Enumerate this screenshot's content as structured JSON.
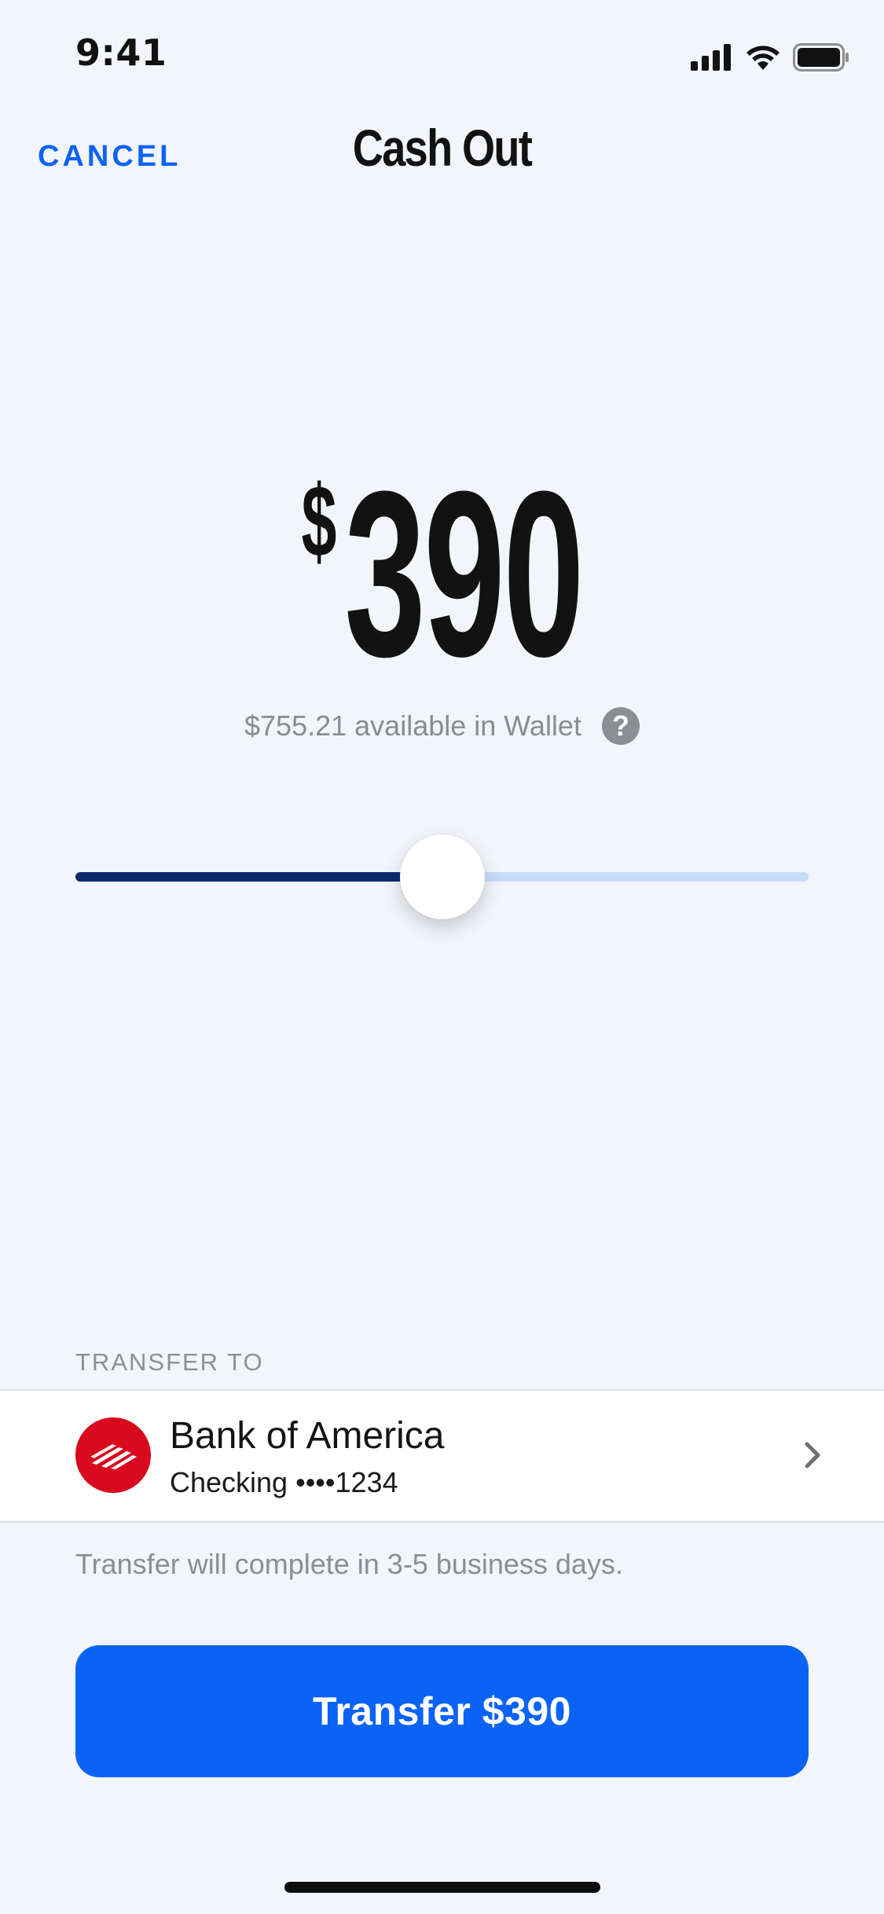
{
  "status_bar": {
    "time": "9:41"
  },
  "nav": {
    "cancel_label": "CANCEL",
    "title": "Cash Out"
  },
  "amount": {
    "currency": "$",
    "value": "390",
    "available_text": "$755.21 available in Wallet",
    "help_symbol": "?"
  },
  "slider": {
    "fraction": 0.5
  },
  "transfer": {
    "section_label": "TRANSFER TO",
    "bank_name": "Bank of America",
    "account": "Checking ••••1234",
    "note": "Transfer will complete in 3-5 business days."
  },
  "cta": {
    "label": "Transfer $390"
  },
  "colors": {
    "accent": "#0b63f6",
    "slider_fill": "#0b2a6a",
    "slider_track": "#c8dbfb",
    "bank_red": "#d80a1f",
    "background": "#f2f5fa"
  },
  "icons": {
    "signal": "cellular-signal-icon",
    "wifi": "wifi-icon",
    "battery": "battery-icon",
    "help": "help-icon",
    "bank": "bank-of-america-logo-icon",
    "chevron": "chevron-right-icon"
  }
}
